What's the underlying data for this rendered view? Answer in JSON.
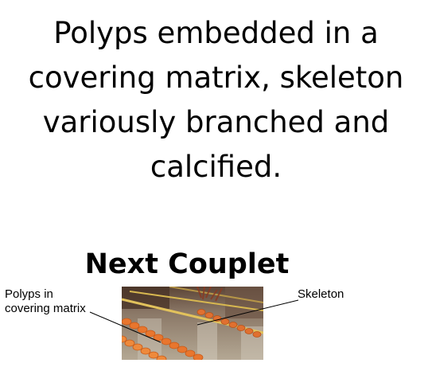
{
  "description": {
    "lines": [
      "Polyps embedded in a",
      "covering matrix, skeleton",
      "variously branched and",
      "calcified."
    ]
  },
  "next_couplet": "Next Couplet",
  "labels": {
    "polyps_line1": "Polyps in",
    "polyps_line2": "covering matrix",
    "skeleton": "Skeleton"
  }
}
